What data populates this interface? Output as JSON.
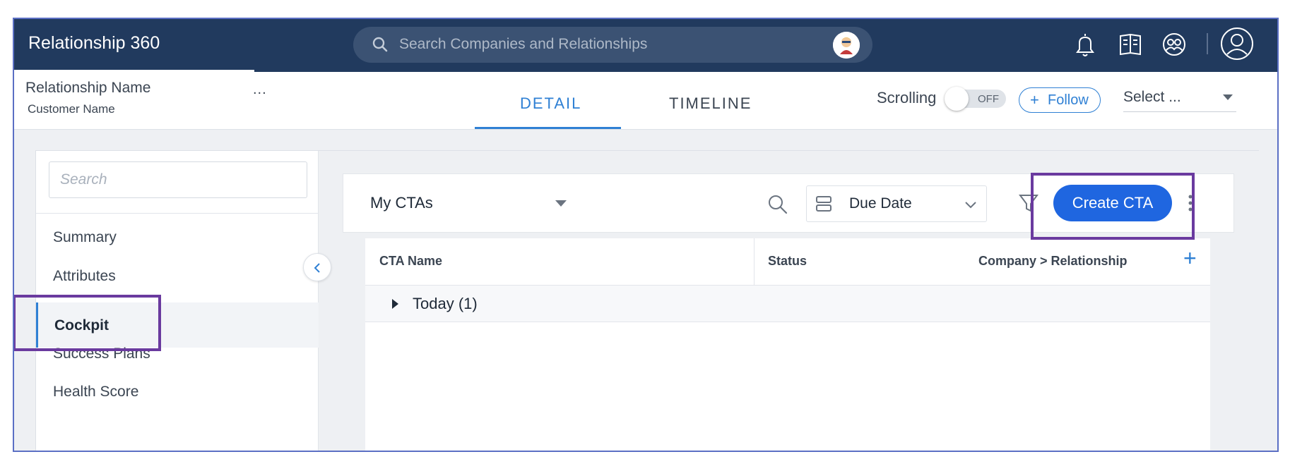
{
  "app": {
    "title": "Relationship 360"
  },
  "global_search": {
    "placeholder": "Search Companies and Relationships"
  },
  "header": {
    "relationship_name": "Relationship Name",
    "customer_name": "Customer Name",
    "more": "...",
    "tabs": [
      {
        "label": "DETAIL",
        "active": true
      },
      {
        "label": "TIMELINE",
        "active": false
      }
    ],
    "scrolling_label": "Scrolling",
    "scrolling_toggle": "OFF",
    "follow_label": "Follow",
    "select_label": "Select ..."
  },
  "sidebar": {
    "search_placeholder": "Search",
    "items": [
      {
        "label": "Summary"
      },
      {
        "label": "Attributes"
      },
      {
        "label": "Cockpit",
        "active": true
      },
      {
        "label": "Success Plans"
      },
      {
        "label": "Health Score"
      }
    ]
  },
  "cockpit": {
    "view_label": "My CTAs",
    "sort_label": "Due Date",
    "create_label": "Create CTA",
    "columns": [
      "CTA Name",
      "Status",
      "Company > Relationship"
    ],
    "groups": [
      {
        "label": "Today (1)"
      }
    ]
  },
  "colors": {
    "nav_bg": "#213a5e",
    "accent": "#2f80d4",
    "primary_button": "#1f66e0",
    "highlight": "#6a3a9f"
  }
}
